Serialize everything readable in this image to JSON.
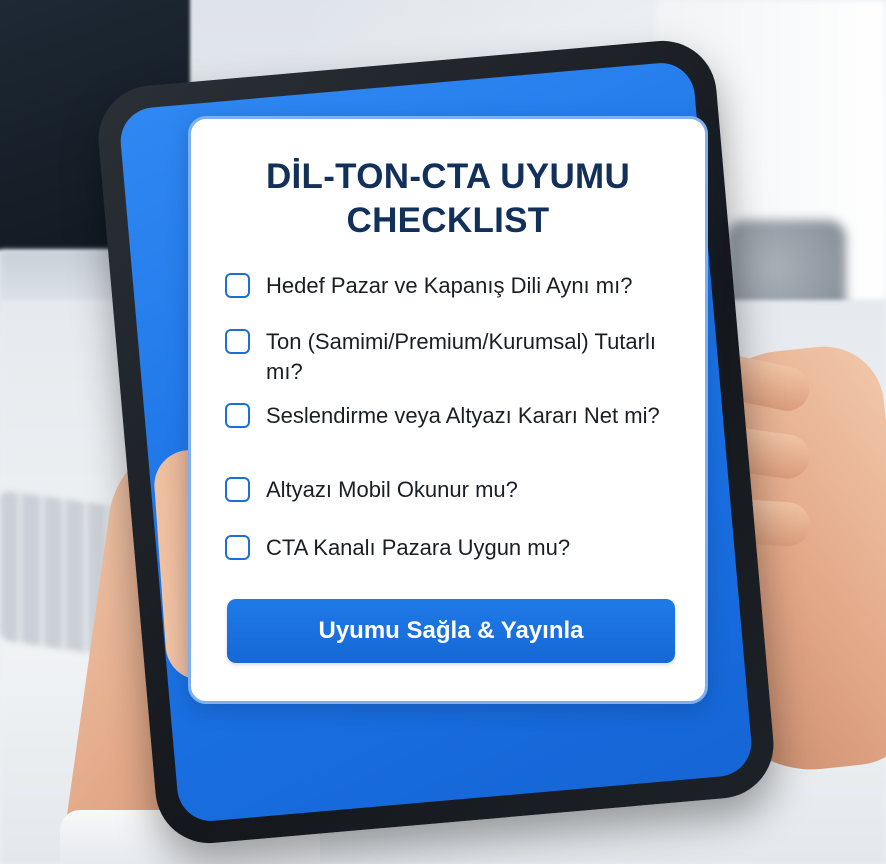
{
  "card": {
    "title": "DİL-TON-CTA UYUMU CHECKLIST",
    "accent_color": "#1c6fd8",
    "title_color": "#12305a"
  },
  "checklist": {
    "items": [
      {
        "label": "Hedef Pazar ve Kapanış Dili Aynı mı?",
        "checked": false
      },
      {
        "label": "Ton (Samimi/Premium/Kurumsal) Tutarlı mı?",
        "checked": false
      },
      {
        "label": "Seslendirme veya Altyazı Kararı Net mi?",
        "checked": false
      },
      {
        "label": "Altyazı Mobil Okunur mu?",
        "checked": false
      },
      {
        "label": "CTA Kanalı Pazara Uygun mu?",
        "checked": false
      }
    ]
  },
  "cta_button": {
    "label": "Uyumu Sağla & Yayınla",
    "color": "#1f7ae8"
  }
}
